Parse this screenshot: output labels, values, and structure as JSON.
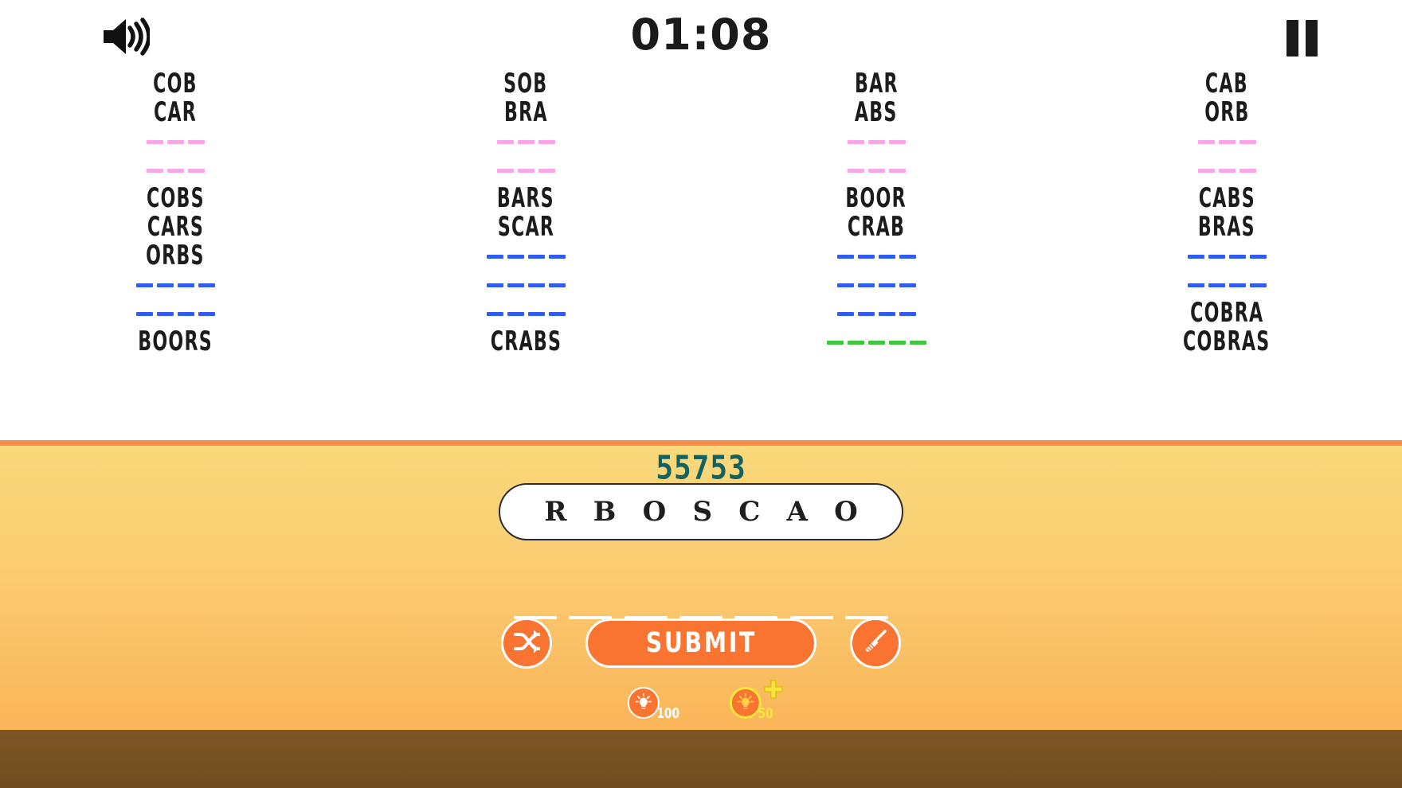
{
  "header": {
    "timer": "01:08",
    "sound_icon": "speaker-on-icon",
    "pause_icon": "pause-icon"
  },
  "board": {
    "columns": [
      {
        "id": "column-1",
        "rows": [
          {
            "type": "word",
            "text": "COB"
          },
          {
            "type": "word",
            "text": "CAR"
          },
          {
            "type": "dashes",
            "count": 3,
            "color": "pink"
          },
          {
            "type": "dashes",
            "count": 3,
            "color": "pink"
          },
          {
            "type": "word",
            "text": "COBS"
          },
          {
            "type": "word",
            "text": "CARS"
          },
          {
            "type": "word",
            "text": "ORBS"
          },
          {
            "type": "dashes",
            "count": 4,
            "color": "blue"
          },
          {
            "type": "dashes",
            "count": 4,
            "color": "blue"
          },
          {
            "type": "word",
            "text": "BOORS"
          }
        ]
      },
      {
        "id": "column-2",
        "rows": [
          {
            "type": "word",
            "text": "SOB"
          },
          {
            "type": "word",
            "text": "BRA"
          },
          {
            "type": "dashes",
            "count": 3,
            "color": "pink"
          },
          {
            "type": "dashes",
            "count": 3,
            "color": "pink"
          },
          {
            "type": "word",
            "text": "BARS"
          },
          {
            "type": "word",
            "text": "SCAR"
          },
          {
            "type": "dashes",
            "count": 4,
            "color": "blue"
          },
          {
            "type": "dashes",
            "count": 4,
            "color": "blue"
          },
          {
            "type": "dashes",
            "count": 4,
            "color": "blue"
          },
          {
            "type": "word",
            "text": "CRABS"
          }
        ]
      },
      {
        "id": "column-3",
        "rows": [
          {
            "type": "word",
            "text": "BAR"
          },
          {
            "type": "word",
            "text": "ABS"
          },
          {
            "type": "dashes",
            "count": 3,
            "color": "pink"
          },
          {
            "type": "dashes",
            "count": 3,
            "color": "pink"
          },
          {
            "type": "word",
            "text": "BOOR"
          },
          {
            "type": "word",
            "text": "CRAB"
          },
          {
            "type": "dashes",
            "count": 4,
            "color": "blue"
          },
          {
            "type": "dashes",
            "count": 4,
            "color": "blue"
          },
          {
            "type": "dashes",
            "count": 4,
            "color": "blue"
          },
          {
            "type": "dashes",
            "count": 5,
            "color": "green"
          }
        ]
      },
      {
        "id": "column-4",
        "rows": [
          {
            "type": "word",
            "text": "CAB"
          },
          {
            "type": "word",
            "text": "ORB"
          },
          {
            "type": "dashes",
            "count": 3,
            "color": "pink"
          },
          {
            "type": "dashes",
            "count": 3,
            "color": "pink"
          },
          {
            "type": "word",
            "text": "CABS"
          },
          {
            "type": "word",
            "text": "BRAS"
          },
          {
            "type": "dashes",
            "count": 4,
            "color": "blue"
          },
          {
            "type": "dashes",
            "count": 4,
            "color": "blue"
          },
          {
            "type": "word",
            "text": "COBRA"
          },
          {
            "type": "word",
            "text": "COBRAS"
          }
        ]
      }
    ]
  },
  "panel": {
    "score": "55753",
    "letters": [
      "R",
      "B",
      "O",
      "S",
      "C",
      "A",
      "O"
    ],
    "answer_slot_count": 7,
    "shuffle_icon": "shuffle-icon",
    "clear_icon": "broom-icon",
    "submit_label": "SUBMIT",
    "hints": [
      {
        "id": "hint-reveal-letter",
        "icon": "lightbulb-icon",
        "cost": "100",
        "style": "white"
      },
      {
        "id": "hint-extra-bonus",
        "icon": "lightbulb-plus-icon",
        "cost": "50",
        "style": "gold"
      }
    ]
  },
  "colors": {
    "dash_pink": "#f9a6e8",
    "dash_blue": "#2f5cf5",
    "dash_green": "#3ec63e",
    "accent_orange": "#f87430",
    "divider_orange": "#f58a4b",
    "score_teal": "#14615f",
    "ground_brown": "#7d5723",
    "gold": "#f5e63c"
  }
}
